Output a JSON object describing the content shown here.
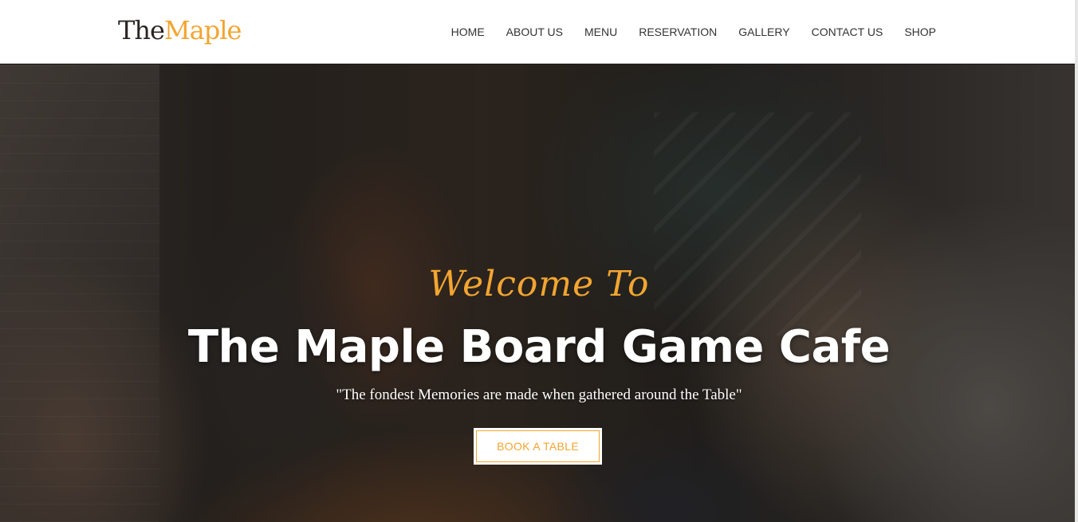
{
  "header": {
    "logo_part1": "The",
    "logo_part2": "Maple",
    "nav": [
      "HOME",
      "ABOUT US",
      "MENU",
      "RESERVATION",
      "GALLERY",
      "CONTACT US",
      "SHOP"
    ]
  },
  "hero": {
    "script_heading": "Welcome To",
    "title": "The Maple Board Game Cafe",
    "tagline": "\"The fondest Memories are made when gathered around the Table\"",
    "cta_label": "BOOK A TABLE"
  },
  "colors": {
    "accent": "#f2a531",
    "logo_dark": "#2b2522",
    "nav_text": "#333333"
  }
}
